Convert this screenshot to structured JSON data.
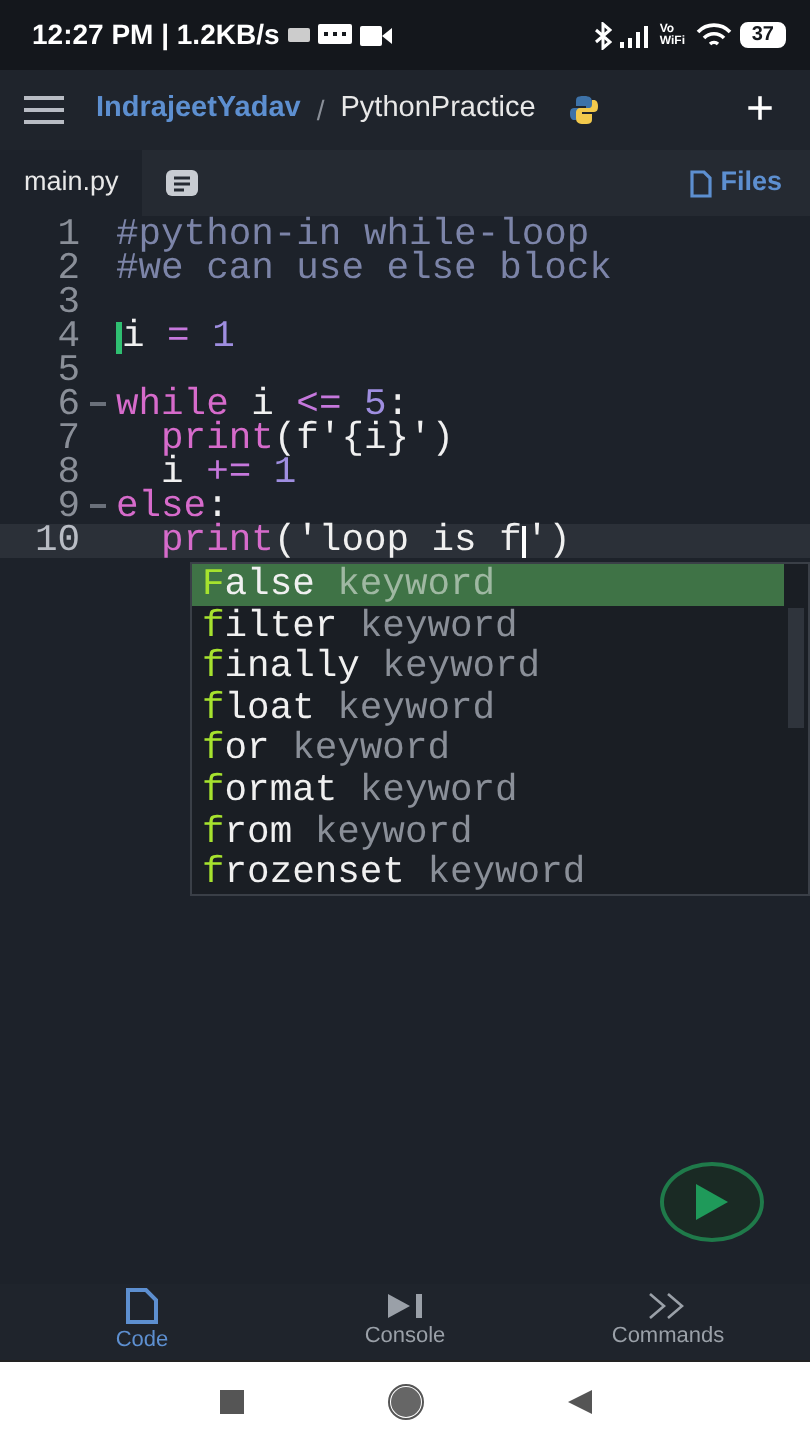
{
  "status_bar": {
    "time": "12:27 PM | 1.2KB/s",
    "volte": "Vo WiFi",
    "battery": "37"
  },
  "app_bar": {
    "owner": "IndrajeetYadav",
    "separator": "/",
    "project": "PythonPractice",
    "add": "+"
  },
  "tabs": [
    {
      "label": "main.py",
      "kind": "file",
      "selected": true
    },
    {
      "kind": "notes",
      "selected": false
    }
  ],
  "files_button": "Files",
  "code_lines": [
    {
      "number": "1",
      "foldable": false,
      "current": false,
      "indented": false,
      "tokens": [
        {
          "text": "#python-in while-loop",
          "kind": "comment"
        }
      ]
    },
    {
      "number": "2",
      "foldable": false,
      "current": false,
      "indented": false,
      "tokens": [
        {
          "text": "#we can use else block",
          "kind": "comment"
        }
      ]
    },
    {
      "number": "3",
      "foldable": false,
      "current": false,
      "indented": false
    },
    {
      "number": "4",
      "foldable": false,
      "current": false,
      "indented": false,
      "tokens": [
        {
          "kind": "marker"
        },
        {
          "text": "i",
          "kind": "name"
        },
        {
          "text": " = ",
          "kind": "operator"
        },
        {
          "text": "1",
          "kind": "number"
        }
      ]
    },
    {
      "number": "5",
      "foldable": false,
      "current": false,
      "indented": false
    },
    {
      "number": "6",
      "foldable": true,
      "current": false,
      "indented": false,
      "tokens": [
        {
          "text": "while",
          "kind": "keyword"
        },
        {
          "text": " i ",
          "kind": "name"
        },
        {
          "text": "<=",
          "kind": "operator"
        },
        {
          "text": " 5",
          "kind": "number"
        },
        {
          "text": ":",
          "kind": "punct"
        }
      ]
    },
    {
      "number": "7",
      "foldable": false,
      "current": false,
      "indented": true,
      "tokens": [
        {
          "text": "print",
          "kind": "keyword"
        },
        {
          "text": "(f'{i}')",
          "kind": "punct"
        }
      ]
    },
    {
      "number": "8",
      "foldable": false,
      "current": false,
      "indented": true,
      "tokens": [
        {
          "text": "i ",
          "kind": "name"
        },
        {
          "text": "+=",
          "kind": "operator"
        },
        {
          "text": " 1",
          "kind": "number"
        }
      ]
    },
    {
      "number": "9",
      "foldable": true,
      "current": false,
      "indented": false,
      "tokens": [
        {
          "text": "else",
          "kind": "keyword"
        },
        {
          "text": ":",
          "kind": "punct"
        }
      ]
    },
    {
      "number": "10",
      "foldable": false,
      "current": true,
      "indented": true,
      "tokens": [
        {
          "text": "print",
          "kind": "keyword"
        },
        {
          "text": "('loop is f",
          "kind": "punct"
        },
        {
          "kind": "caret"
        },
        {
          "text": "')",
          "kind": "punct"
        }
      ]
    }
  ],
  "completions": [
    {
      "match": "F",
      "rest": "alse",
      "detail": "keyword",
      "selected": true
    },
    {
      "match": "f",
      "rest": "ilter",
      "detail": "keyword",
      "selected": false
    },
    {
      "match": "f",
      "rest": "inally",
      "detail": "keyword",
      "selected": false
    },
    {
      "match": "f",
      "rest": "loat",
      "detail": "keyword",
      "selected": false
    },
    {
      "match": "f",
      "rest": "or",
      "detail": "keyword",
      "selected": false
    },
    {
      "match": "f",
      "rest": "ormat",
      "detail": "keyword",
      "selected": false
    },
    {
      "match": "f",
      "rest": "rom",
      "detail": "keyword",
      "selected": false
    },
    {
      "match": "f",
      "rest": "rozenset",
      "detail": "keyword",
      "selected": false
    }
  ],
  "bottom_nav": [
    {
      "label": "Code",
      "kind": "code",
      "selected": true
    },
    {
      "label": "Console",
      "kind": "console",
      "selected": false
    },
    {
      "label": "Commands",
      "kind": "commands",
      "selected": false
    }
  ]
}
